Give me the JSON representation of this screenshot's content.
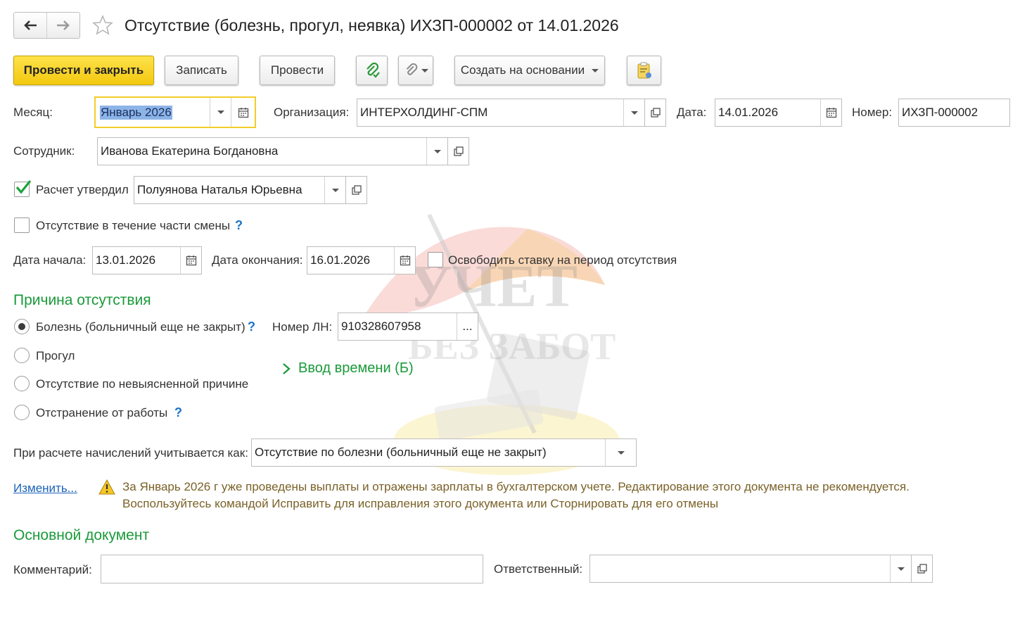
{
  "window": {
    "title": "Отсутствие (болезнь, прогул, неявка) ИХЗП-000002 от 14.01.2026"
  },
  "icons": {
    "back": "arrow-left-icon",
    "forward": "arrow-right-icon",
    "favorite": "star-icon",
    "post_green": "paperclip-green-icon",
    "attach": "paperclip-icon",
    "report": "clipboard-report-icon",
    "calendar": "calendar-icon",
    "open": "open-window-icon",
    "dropdown": "chevron-down-icon",
    "warning": "warning-triangle-icon"
  },
  "toolbar": {
    "post_close": "Провести и закрыть",
    "save": "Записать",
    "post": "Провести",
    "create_based": "Создать на основании"
  },
  "fields": {
    "month_label": "Месяц:",
    "month_value": "Январь 2026",
    "org_label": "Организация:",
    "org_value": "ИНТЕРХОЛДИНГ-СПМ",
    "date_label": "Дата:",
    "date_value": "14.01.2026",
    "number_label": "Номер:",
    "number_value": "ИХЗП-000002",
    "employee_label": "Сотрудник:",
    "employee_value": "Иванова Екатерина Богдановна",
    "approved_label": "Расчет утвердил",
    "approved_value": "Полуянова Наталья Юрьевна",
    "partial_shift_label": "Отсутствие в течение части смены",
    "start_label": "Дата начала:",
    "start_value": "13.01.2026",
    "end_label": "Дата окончания:",
    "end_value": "16.01.2026",
    "release_rate_label": "Освободить ставку на период отсутствия"
  },
  "reason": {
    "title": "Причина отсутствия",
    "options": [
      "Болезнь (больничный еще не закрыт)",
      "Прогул",
      "Отсутствие по невыясненной причине",
      "Отстранение от работы"
    ],
    "ln_label": "Номер ЛН:",
    "ln_value": "910328607958",
    "ln_more": "...",
    "time_input": "Ввод времени (Б)",
    "calc_label": "При расчете начислений учитывается как:",
    "calc_value": "Отсутствие по болезни (больничный еще не закрыт)"
  },
  "warning": {
    "change_link": "Изменить...",
    "line1": "За Январь 2026 г уже проведены выплаты и отражены зарплаты в бухгалтерском учете. Редактирование этого документа не рекомендуется.",
    "line2": "Воспользуйтесь командой Исправить для исправления этого документа или Сторнировать для его отмены"
  },
  "main_doc": {
    "title": "Основной документ",
    "comment_label": "Комментарий:",
    "comment_value": "",
    "responsible_label": "Ответственный:",
    "responsible_value": ""
  },
  "watermark": {
    "line1": "УЧЕТ",
    "line2": "БЕЗ ЗАБОТ"
  },
  "colors": {
    "primary_button": "#f5cd1a",
    "section_title": "#1a9a3a",
    "link": "#1a62b8",
    "warning_text": "#7a6128"
  }
}
